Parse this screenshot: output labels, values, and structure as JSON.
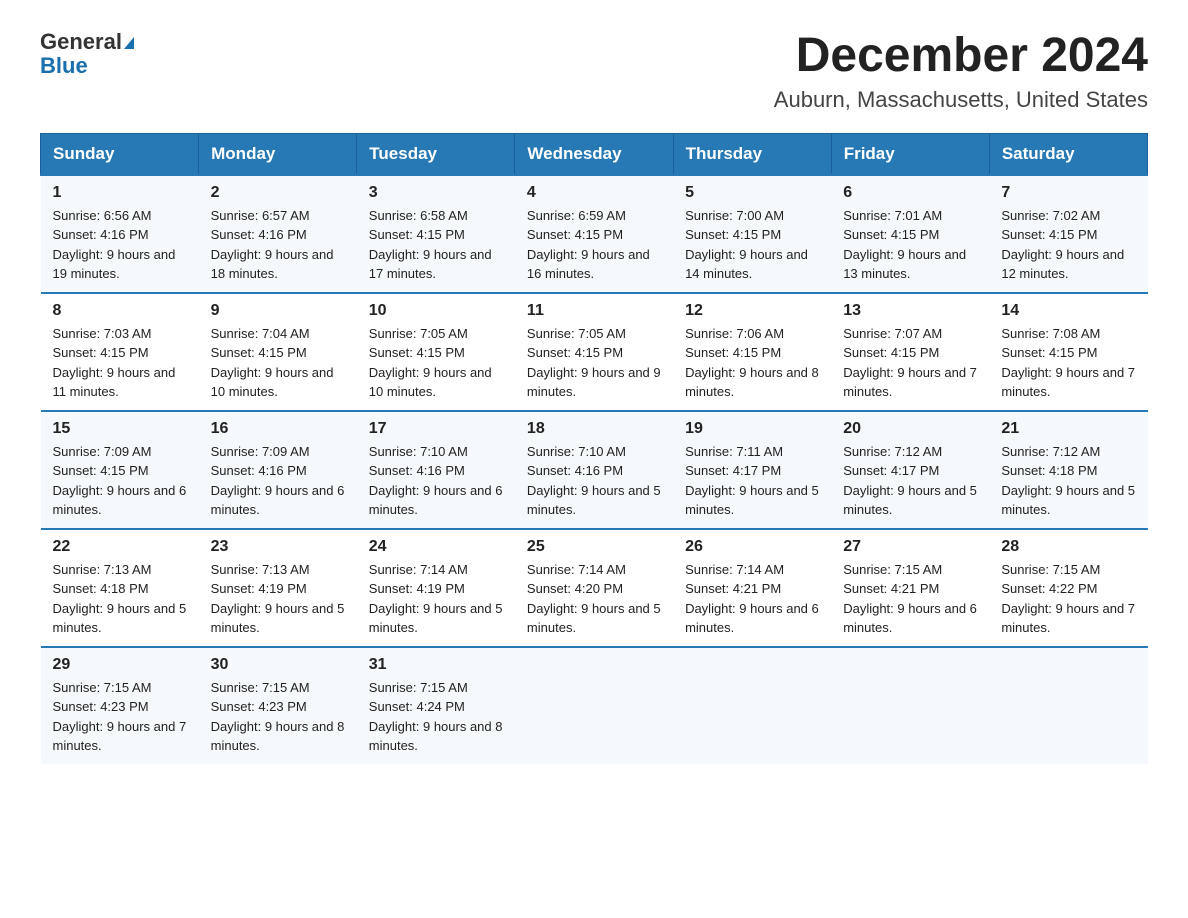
{
  "header": {
    "logo_general": "General",
    "logo_blue": "Blue",
    "month_title": "December 2024",
    "location": "Auburn, Massachusetts, United States"
  },
  "days_of_week": [
    "Sunday",
    "Monday",
    "Tuesday",
    "Wednesday",
    "Thursday",
    "Friday",
    "Saturday"
  ],
  "weeks": [
    [
      {
        "day": "1",
        "sunrise": "Sunrise: 6:56 AM",
        "sunset": "Sunset: 4:16 PM",
        "daylight": "Daylight: 9 hours and 19 minutes."
      },
      {
        "day": "2",
        "sunrise": "Sunrise: 6:57 AM",
        "sunset": "Sunset: 4:16 PM",
        "daylight": "Daylight: 9 hours and 18 minutes."
      },
      {
        "day": "3",
        "sunrise": "Sunrise: 6:58 AM",
        "sunset": "Sunset: 4:15 PM",
        "daylight": "Daylight: 9 hours and 17 minutes."
      },
      {
        "day": "4",
        "sunrise": "Sunrise: 6:59 AM",
        "sunset": "Sunset: 4:15 PM",
        "daylight": "Daylight: 9 hours and 16 minutes."
      },
      {
        "day": "5",
        "sunrise": "Sunrise: 7:00 AM",
        "sunset": "Sunset: 4:15 PM",
        "daylight": "Daylight: 9 hours and 14 minutes."
      },
      {
        "day": "6",
        "sunrise": "Sunrise: 7:01 AM",
        "sunset": "Sunset: 4:15 PM",
        "daylight": "Daylight: 9 hours and 13 minutes."
      },
      {
        "day": "7",
        "sunrise": "Sunrise: 7:02 AM",
        "sunset": "Sunset: 4:15 PM",
        "daylight": "Daylight: 9 hours and 12 minutes."
      }
    ],
    [
      {
        "day": "8",
        "sunrise": "Sunrise: 7:03 AM",
        "sunset": "Sunset: 4:15 PM",
        "daylight": "Daylight: 9 hours and 11 minutes."
      },
      {
        "day": "9",
        "sunrise": "Sunrise: 7:04 AM",
        "sunset": "Sunset: 4:15 PM",
        "daylight": "Daylight: 9 hours and 10 minutes."
      },
      {
        "day": "10",
        "sunrise": "Sunrise: 7:05 AM",
        "sunset": "Sunset: 4:15 PM",
        "daylight": "Daylight: 9 hours and 10 minutes."
      },
      {
        "day": "11",
        "sunrise": "Sunrise: 7:05 AM",
        "sunset": "Sunset: 4:15 PM",
        "daylight": "Daylight: 9 hours and 9 minutes."
      },
      {
        "day": "12",
        "sunrise": "Sunrise: 7:06 AM",
        "sunset": "Sunset: 4:15 PM",
        "daylight": "Daylight: 9 hours and 8 minutes."
      },
      {
        "day": "13",
        "sunrise": "Sunrise: 7:07 AM",
        "sunset": "Sunset: 4:15 PM",
        "daylight": "Daylight: 9 hours and 7 minutes."
      },
      {
        "day": "14",
        "sunrise": "Sunrise: 7:08 AM",
        "sunset": "Sunset: 4:15 PM",
        "daylight": "Daylight: 9 hours and 7 minutes."
      }
    ],
    [
      {
        "day": "15",
        "sunrise": "Sunrise: 7:09 AM",
        "sunset": "Sunset: 4:15 PM",
        "daylight": "Daylight: 9 hours and 6 minutes."
      },
      {
        "day": "16",
        "sunrise": "Sunrise: 7:09 AM",
        "sunset": "Sunset: 4:16 PM",
        "daylight": "Daylight: 9 hours and 6 minutes."
      },
      {
        "day": "17",
        "sunrise": "Sunrise: 7:10 AM",
        "sunset": "Sunset: 4:16 PM",
        "daylight": "Daylight: 9 hours and 6 minutes."
      },
      {
        "day": "18",
        "sunrise": "Sunrise: 7:10 AM",
        "sunset": "Sunset: 4:16 PM",
        "daylight": "Daylight: 9 hours and 5 minutes."
      },
      {
        "day": "19",
        "sunrise": "Sunrise: 7:11 AM",
        "sunset": "Sunset: 4:17 PM",
        "daylight": "Daylight: 9 hours and 5 minutes."
      },
      {
        "day": "20",
        "sunrise": "Sunrise: 7:12 AM",
        "sunset": "Sunset: 4:17 PM",
        "daylight": "Daylight: 9 hours and 5 minutes."
      },
      {
        "day": "21",
        "sunrise": "Sunrise: 7:12 AM",
        "sunset": "Sunset: 4:18 PM",
        "daylight": "Daylight: 9 hours and 5 minutes."
      }
    ],
    [
      {
        "day": "22",
        "sunrise": "Sunrise: 7:13 AM",
        "sunset": "Sunset: 4:18 PM",
        "daylight": "Daylight: 9 hours and 5 minutes."
      },
      {
        "day": "23",
        "sunrise": "Sunrise: 7:13 AM",
        "sunset": "Sunset: 4:19 PM",
        "daylight": "Daylight: 9 hours and 5 minutes."
      },
      {
        "day": "24",
        "sunrise": "Sunrise: 7:14 AM",
        "sunset": "Sunset: 4:19 PM",
        "daylight": "Daylight: 9 hours and 5 minutes."
      },
      {
        "day": "25",
        "sunrise": "Sunrise: 7:14 AM",
        "sunset": "Sunset: 4:20 PM",
        "daylight": "Daylight: 9 hours and 5 minutes."
      },
      {
        "day": "26",
        "sunrise": "Sunrise: 7:14 AM",
        "sunset": "Sunset: 4:21 PM",
        "daylight": "Daylight: 9 hours and 6 minutes."
      },
      {
        "day": "27",
        "sunrise": "Sunrise: 7:15 AM",
        "sunset": "Sunset: 4:21 PM",
        "daylight": "Daylight: 9 hours and 6 minutes."
      },
      {
        "day": "28",
        "sunrise": "Sunrise: 7:15 AM",
        "sunset": "Sunset: 4:22 PM",
        "daylight": "Daylight: 9 hours and 7 minutes."
      }
    ],
    [
      {
        "day": "29",
        "sunrise": "Sunrise: 7:15 AM",
        "sunset": "Sunset: 4:23 PM",
        "daylight": "Daylight: 9 hours and 7 minutes."
      },
      {
        "day": "30",
        "sunrise": "Sunrise: 7:15 AM",
        "sunset": "Sunset: 4:23 PM",
        "daylight": "Daylight: 9 hours and 8 minutes."
      },
      {
        "day": "31",
        "sunrise": "Sunrise: 7:15 AM",
        "sunset": "Sunset: 4:24 PM",
        "daylight": "Daylight: 9 hours and 8 minutes."
      },
      {
        "day": "",
        "sunrise": "",
        "sunset": "",
        "daylight": ""
      },
      {
        "day": "",
        "sunrise": "",
        "sunset": "",
        "daylight": ""
      },
      {
        "day": "",
        "sunrise": "",
        "sunset": "",
        "daylight": ""
      },
      {
        "day": "",
        "sunrise": "",
        "sunset": "",
        "daylight": ""
      }
    ]
  ]
}
